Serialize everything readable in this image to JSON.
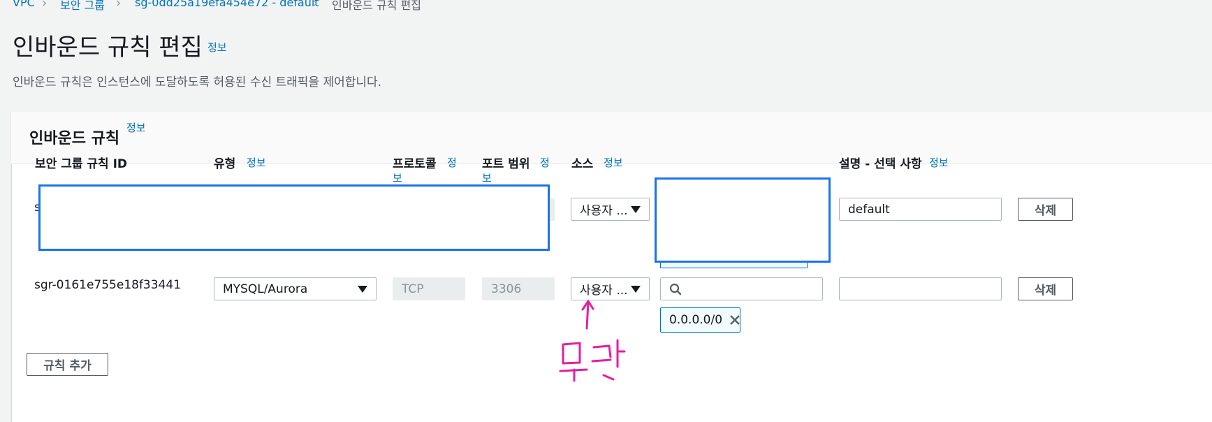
{
  "breadcrumbs": [
    {
      "label": "VPC"
    },
    {
      "label": "보안 그룹"
    },
    {
      "label": "sg-0dd25a19efa454e72 - default"
    },
    {
      "label": "인바운드 규칙 편집"
    }
  ],
  "page": {
    "title": "인바운드 규칙 편집",
    "info": "정보",
    "description": "인바운드 규칙은 인스턴스에 도달하도록 허용된 수신 트래픽을 제어합니다."
  },
  "panel": {
    "title": "인바운드 규칙",
    "info": "정보"
  },
  "columns": {
    "rule_id": "보안 그룹 규칙 ID",
    "type": "유형",
    "type_info": "정보",
    "protocol_l1": "프로토콜",
    "protocol_info_a": "정",
    "protocol_info_b": "보",
    "port_l1": "포트 범위",
    "port_info_a": "정",
    "port_info_b": "보",
    "source": "소스",
    "source_info": "정보",
    "description": "설명 - 선택 사항",
    "description_info": "정보"
  },
  "rows": [
    {
      "rule_id_partial": "s",
      "source_type": "사용자 ...",
      "description_value": "default",
      "delete_label": "삭제"
    },
    {
      "rule_id": "sgr-0161e755e18f33441",
      "type": "MYSQL/Aurora",
      "protocol": "TCP",
      "port": "3306",
      "source_type": "사용자 ...",
      "source_search_value": "",
      "cidr_token": "0.0.0.0/0",
      "description_value": "",
      "delete_label": "삭제"
    }
  ],
  "add_rule_label": "규칙 추가",
  "annotation": {
    "text": "무관",
    "color": "#e61ea0"
  },
  "colors": {
    "link": "#0073bb",
    "redaction_border": "#1a73e8",
    "background": "#f2f3f3"
  }
}
